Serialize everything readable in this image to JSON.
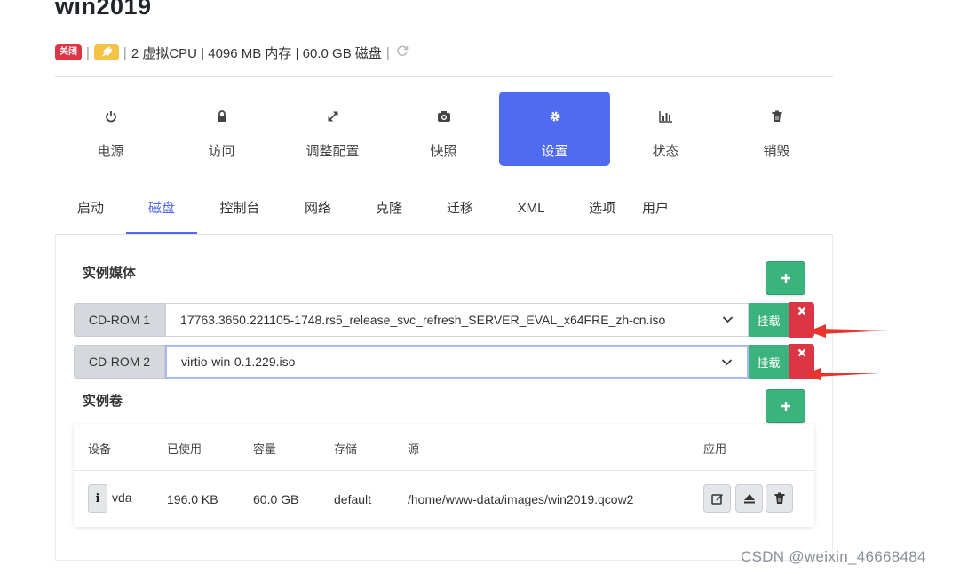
{
  "vm": {
    "name": "win2019",
    "status_badge": "关闭",
    "specs": "2 虚拟CPU | 4096 MB 内存 | 60.0 GB 磁盘",
    "divider": "|"
  },
  "actions": [
    {
      "label": "电源",
      "icon": "power-icon"
    },
    {
      "label": "访问",
      "icon": "lock-icon"
    },
    {
      "label": "调整配置",
      "icon": "resize-icon"
    },
    {
      "label": "快照",
      "icon": "camera-icon"
    },
    {
      "label": "设置",
      "icon": "gear-icon",
      "active": true
    },
    {
      "label": "状态",
      "icon": "bar-chart-icon"
    },
    {
      "label": "销毁",
      "icon": "trash-icon"
    }
  ],
  "tabs": [
    {
      "label": "启动"
    },
    {
      "label": "磁盘",
      "active": true
    },
    {
      "label": "控制台"
    },
    {
      "label": "网络"
    },
    {
      "label": "克隆"
    },
    {
      "label": "迁移"
    },
    {
      "label": "XML"
    },
    {
      "label": "选项"
    },
    {
      "label": "用户"
    }
  ],
  "media": {
    "title": "实例媒体",
    "mount_label": "挂载",
    "drives": [
      {
        "label": "CD-ROM 1",
        "selected": "17763.3650.221105-1748.rs5_release_svc_refresh_SERVER_EVAL_x64FRE_zh-cn.iso"
      },
      {
        "label": "CD-ROM 2",
        "selected": "virtio-win-0.1.229.iso"
      }
    ]
  },
  "volumes": {
    "title": "实例卷",
    "headers": {
      "device": "设备",
      "used": "已使用",
      "capacity": "容量",
      "storage": "存储",
      "source": "源",
      "apply": "应用"
    },
    "rows": [
      {
        "device": "vda",
        "used": "196.0 KB",
        "capacity": "60.0 GB",
        "storage": "default",
        "source": "/home/www-data/images/win2019.qcow2"
      }
    ]
  },
  "watermark": "CSDN @weixin_46668484",
  "colors": {
    "primary": "#4f6cf0",
    "success": "#3bb37c",
    "danger": "#dc3545",
    "warning": "#f4c244"
  }
}
